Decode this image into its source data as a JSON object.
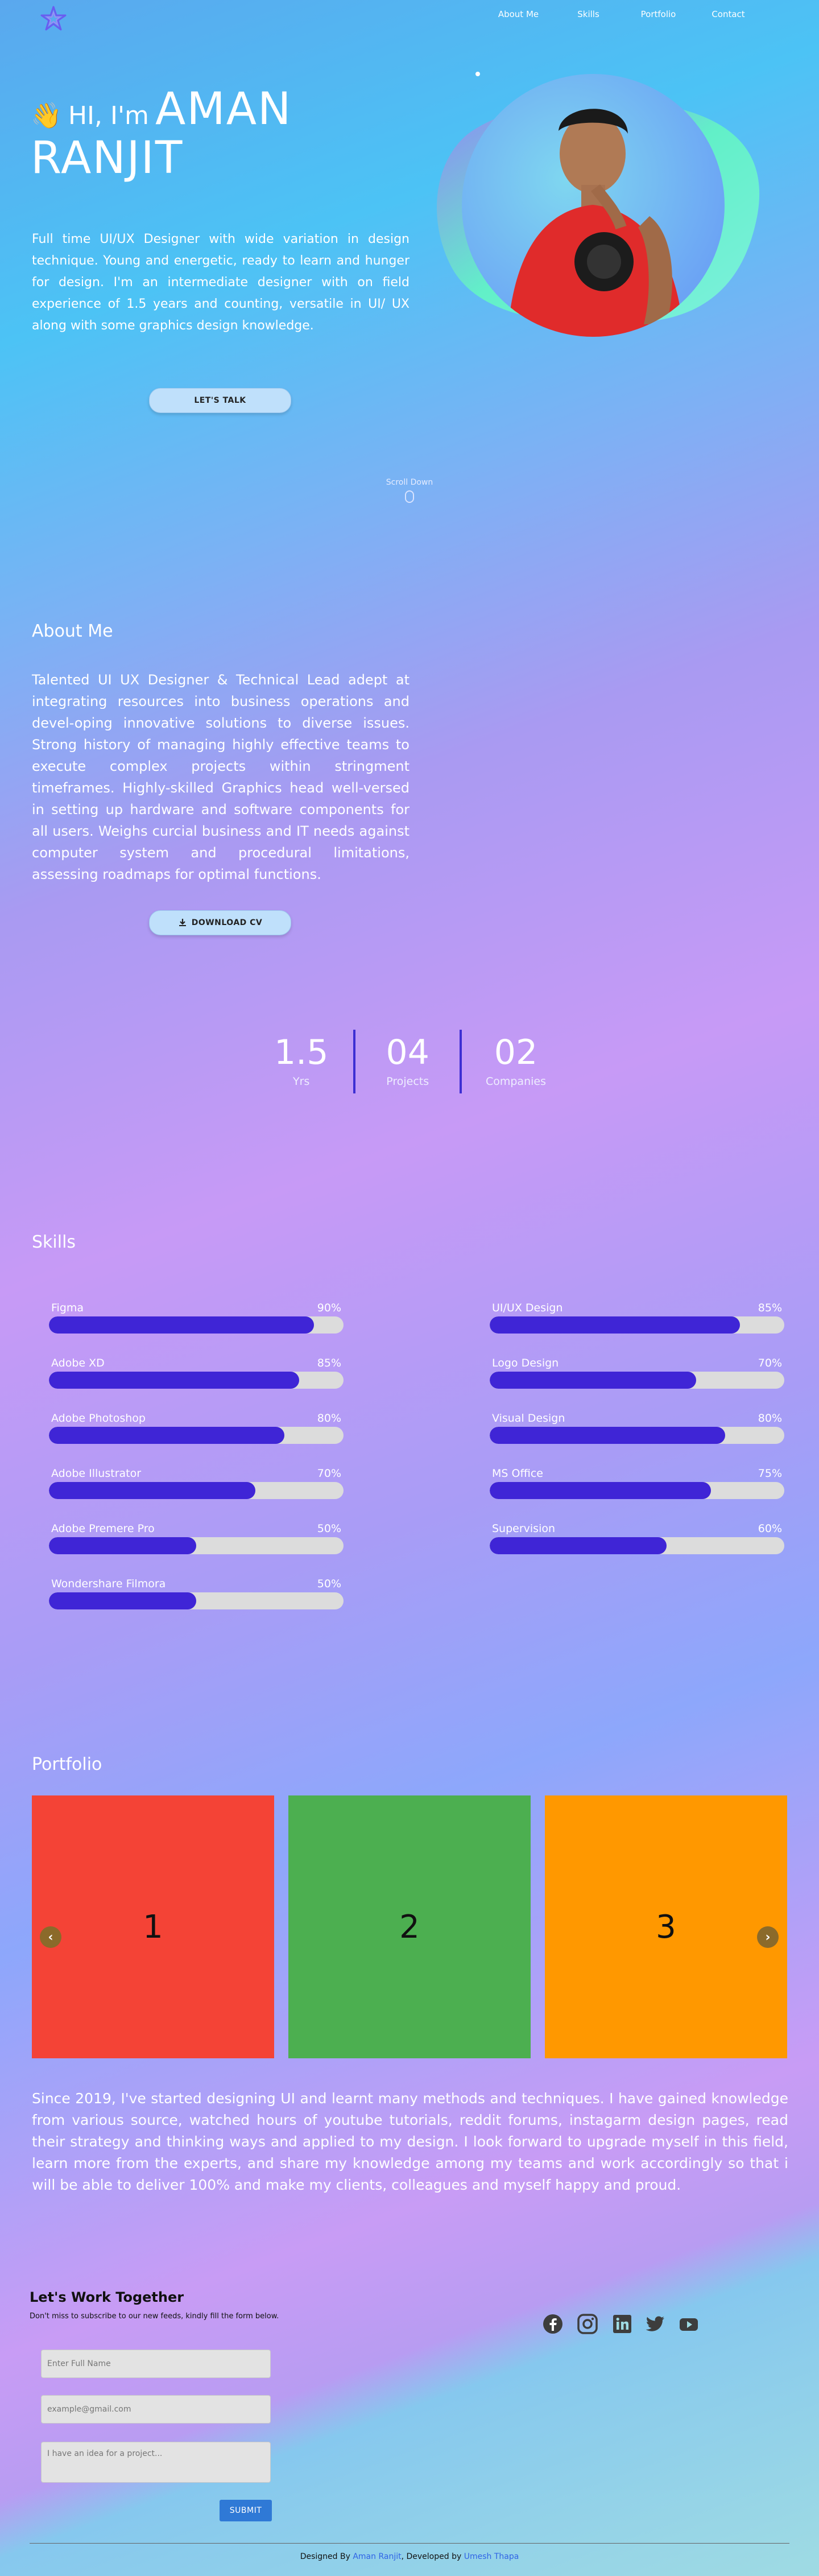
{
  "nav": {
    "logo": "star-logo",
    "items": [
      {
        "label": "About Me"
      },
      {
        "label": "Skills"
      },
      {
        "label": "Portfolio"
      },
      {
        "label": "Contact"
      }
    ]
  },
  "hero": {
    "wave": "👋",
    "greeting": "HI, I'm",
    "first_name": "AMAN",
    "last_name": "RANJIT",
    "description": "Full time UI/UX Designer with wide variation in design technique. Young and energetic, ready to learn and hunger for design. I'm an intermediate designer with on field experience of 1.5 years and counting, versatile in UI/ UX along with some graphics design knowledge.",
    "cta_label": "LET'S TALK",
    "scroll_label": "Scroll Down"
  },
  "about": {
    "title": "About Me",
    "description": "Talented UI UX Designer & Technical Lead adept at integrating resources into business operations and devel-oping innovative solutions to diverse issues. Strong history of managing highly effective teams to execute complex projects within stringment timeframes. Highly-skilled Graphics head well-versed in setting up hardware and software components for all users. Weighs curcial business and IT needs against computer system and procedural limitations, assessing roadmaps for optimal functions.",
    "cv_label": "DOWNLOAD CV",
    "stats": [
      {
        "value": "1.5",
        "label": "Yrs"
      },
      {
        "value": "04",
        "label": "Projects"
      },
      {
        "value": "02",
        "label": "Companies"
      }
    ]
  },
  "skills": {
    "title": "Skills",
    "left": [
      {
        "name": "Figma",
        "percent_label": "90%",
        "level": 90
      },
      {
        "name": "Adobe XD",
        "percent_label": "85%",
        "level": 85
      },
      {
        "name": "Adobe Photoshop",
        "percent_label": "80%",
        "level": 80
      },
      {
        "name": "Adobe Illustrator",
        "percent_label": "70%",
        "level": 70
      },
      {
        "name": "Adobe Premere Pro",
        "percent_label": "50%",
        "level": 50
      },
      {
        "name": "Wondershare Filmora",
        "percent_label": "50%",
        "level": 50
      }
    ],
    "right": [
      {
        "name": "UI/UX Design",
        "percent_label": "85%",
        "level": 85
      },
      {
        "name": "Logo Design",
        "percent_label": "70%",
        "level": 70
      },
      {
        "name": "Visual Design",
        "percent_label": "80%",
        "level": 80
      },
      {
        "name": "MS Office",
        "percent_label": "75%",
        "level": 75
      },
      {
        "name": "Supervision",
        "percent_label": "60%",
        "level": 60
      }
    ],
    "bar_color": "#3f25d6"
  },
  "portfolio": {
    "title": "Portfolio",
    "slides": [
      {
        "label": "1",
        "color": "#f44336"
      },
      {
        "label": "2",
        "color": "#4caf50"
      },
      {
        "label": "3",
        "color": "#ff9800"
      }
    ],
    "prev_icon": "‹",
    "next_icon": "›",
    "description": "Since 2019, I've started designing UI and learnt many methods and techniques. I have gained knowledge from various source, watched hours of youtube tutorials, reddit forums, instagarm design pages, read their strategy and thinking ways and applied to my design. I look forward to upgrade myself in this field, learn more from the experts, and share my knowledge among my teams and work accordingly so that i will be able to deliver 100% and make my clients, colleagues and myself happy and proud."
  },
  "contact": {
    "title": "Let's Work Together",
    "subtitle": "Don't miss to subscribe to our new feeds, kindly fill the form below.",
    "name_placeholder": "Enter Full Name",
    "email_placeholder": "example@gmail.com",
    "message_placeholder": "I have an idea for a project...",
    "submit_label": "SUBMIT",
    "socials": [
      "facebook-icon",
      "instagram-icon",
      "linkedin-icon",
      "twitter-icon",
      "youtube-icon"
    ]
  },
  "footer": {
    "designed_prefix": "Designed By",
    "designer": "Aman Ranjit",
    "developed_prefix": ", Developed by",
    "developer": "Umesh Thapa"
  }
}
